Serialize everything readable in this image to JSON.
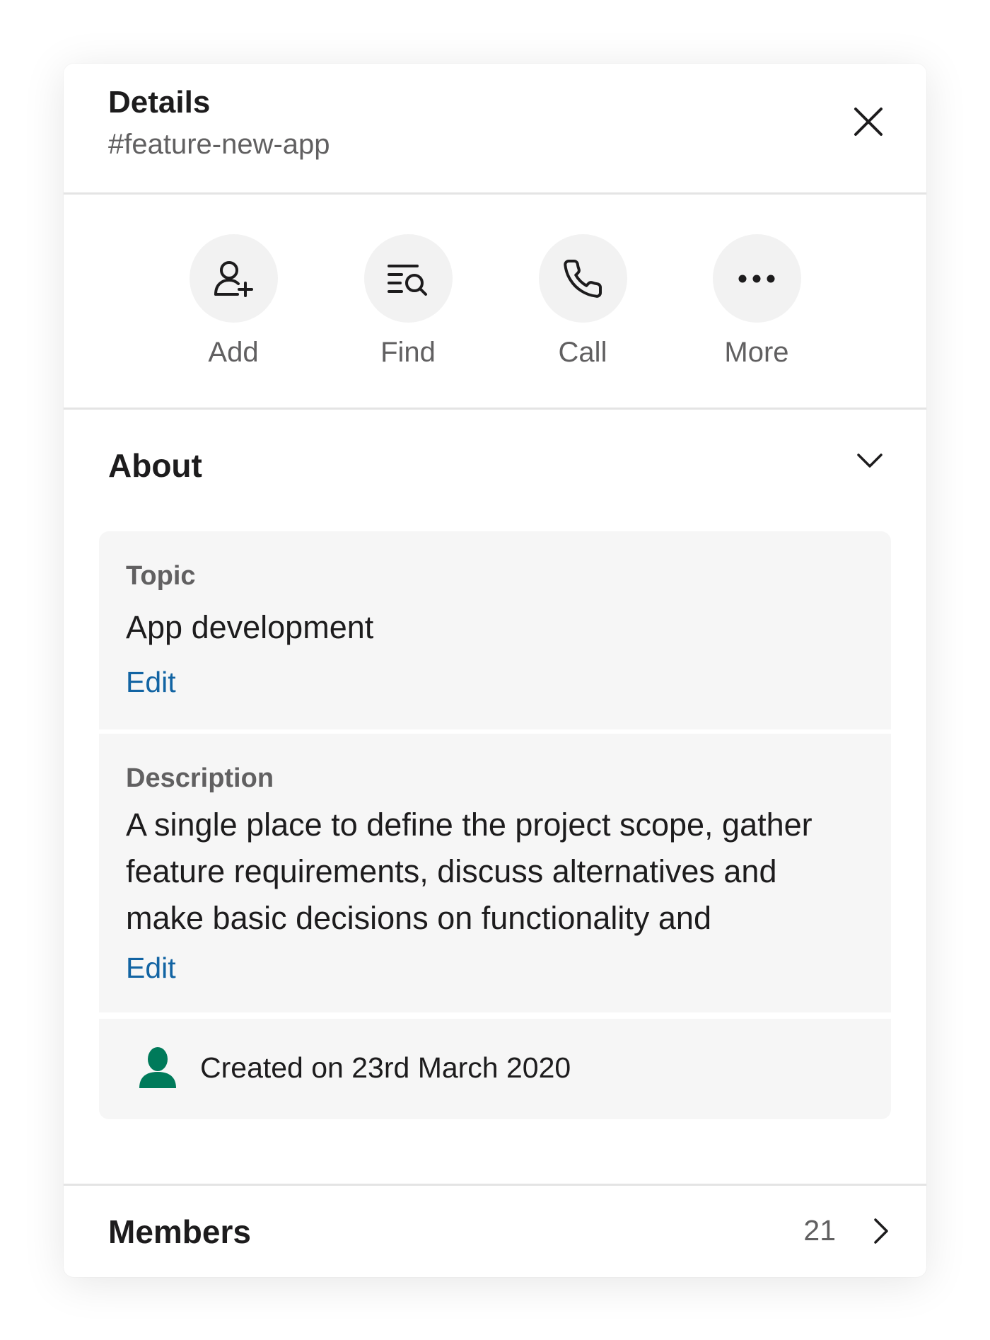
{
  "header": {
    "title": "Details",
    "channel": "#feature-new-app"
  },
  "actions": [
    {
      "label": "Add",
      "icon": "add-user-icon"
    },
    {
      "label": "Find",
      "icon": "find-in-channel-icon"
    },
    {
      "label": "Call",
      "icon": "phone-icon"
    },
    {
      "label": "More",
      "icon": "more-dots-icon"
    }
  ],
  "about": {
    "title": "About",
    "topic": {
      "label": "Topic",
      "value": "App development",
      "edit_label": "Edit"
    },
    "description": {
      "label": "Description",
      "value": "A single place to define the project scope, gather feature requirements, discuss alternatives and make basic decisions on functionality and",
      "edit_label": "Edit"
    },
    "created": "Created on 23rd March 2020"
  },
  "members": {
    "title": "Members",
    "count": "21"
  },
  "colors": {
    "link": "#1264a3",
    "creator_icon": "#007a5a",
    "card_background": "#f6f6f6",
    "secondary_text": "#616061"
  }
}
